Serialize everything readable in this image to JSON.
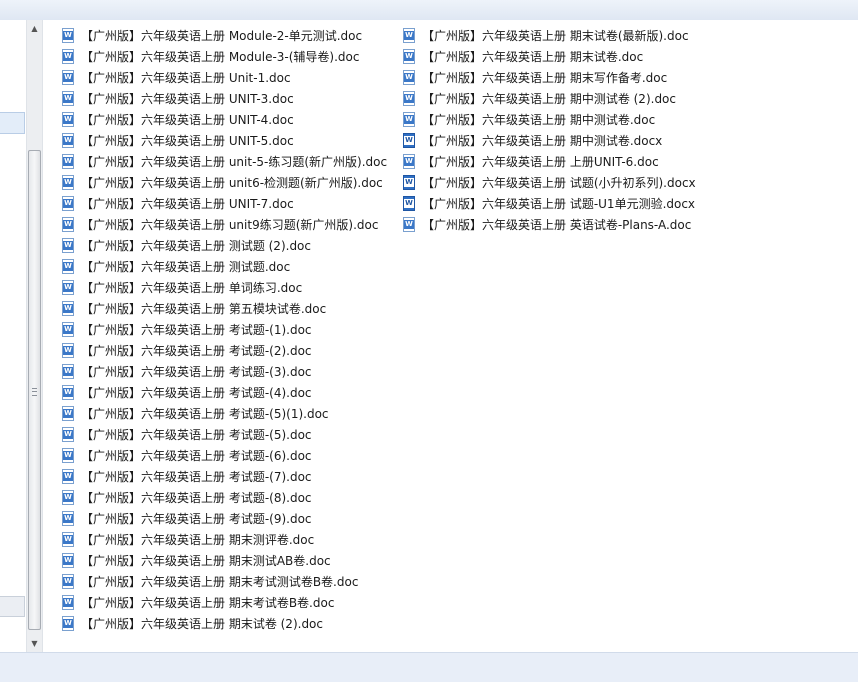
{
  "files_col1": [
    {
      "name": "【广州版】六年级英语上册 Module-2-单元测试.doc",
      "type": "doc"
    },
    {
      "name": "【广州版】六年级英语上册 Module-3-(辅导卷).doc",
      "type": "doc"
    },
    {
      "name": "【广州版】六年级英语上册 Unit-1.doc",
      "type": "doc"
    },
    {
      "name": "【广州版】六年级英语上册 UNIT-3.doc",
      "type": "doc"
    },
    {
      "name": "【广州版】六年级英语上册 UNIT-4.doc",
      "type": "doc"
    },
    {
      "name": "【广州版】六年级英语上册 UNIT-5.doc",
      "type": "doc"
    },
    {
      "name": "【广州版】六年级英语上册 unit-5-练习题(新广州版).doc",
      "type": "doc"
    },
    {
      "name": "【广州版】六年级英语上册 unit6-检测题(新广州版).doc",
      "type": "doc"
    },
    {
      "name": "【广州版】六年级英语上册 UNIT-7.doc",
      "type": "doc"
    },
    {
      "name": "【广州版】六年级英语上册 unit9练习题(新广州版).doc",
      "type": "doc"
    },
    {
      "name": "【广州版】六年级英语上册 测试题 (2).doc",
      "type": "doc"
    },
    {
      "name": "【广州版】六年级英语上册 测试题.doc",
      "type": "doc"
    },
    {
      "name": "【广州版】六年级英语上册 单词练习.doc",
      "type": "doc"
    },
    {
      "name": "【广州版】六年级英语上册 第五模块试卷.doc",
      "type": "doc"
    },
    {
      "name": "【广州版】六年级英语上册 考试题-(1).doc",
      "type": "doc"
    },
    {
      "name": "【广州版】六年级英语上册 考试题-(2).doc",
      "type": "doc"
    },
    {
      "name": "【广州版】六年级英语上册 考试题-(3).doc",
      "type": "doc"
    },
    {
      "name": "【广州版】六年级英语上册 考试题-(4).doc",
      "type": "doc"
    },
    {
      "name": "【广州版】六年级英语上册 考试题-(5)(1).doc",
      "type": "doc"
    },
    {
      "name": "【广州版】六年级英语上册 考试题-(5).doc",
      "type": "doc"
    },
    {
      "name": "【广州版】六年级英语上册 考试题-(6).doc",
      "type": "doc"
    },
    {
      "name": "【广州版】六年级英语上册 考试题-(7).doc",
      "type": "doc"
    },
    {
      "name": "【广州版】六年级英语上册 考试题-(8).doc",
      "type": "doc"
    },
    {
      "name": "【广州版】六年级英语上册 考试题-(9).doc",
      "type": "doc"
    },
    {
      "name": "【广州版】六年级英语上册 期末测评卷.doc",
      "type": "doc"
    },
    {
      "name": "【广州版】六年级英语上册 期末测试AB卷.doc",
      "type": "doc"
    },
    {
      "name": "【广州版】六年级英语上册 期末考试测试卷B卷.doc",
      "type": "doc"
    },
    {
      "name": "【广州版】六年级英语上册 期末考试卷B卷.doc",
      "type": "doc"
    },
    {
      "name": "【广州版】六年级英语上册 期末试卷 (2).doc",
      "type": "doc"
    }
  ],
  "files_col2": [
    {
      "name": "【广州版】六年级英语上册 期末试卷(最新版).doc",
      "type": "doc"
    },
    {
      "name": "【广州版】六年级英语上册 期末试卷.doc",
      "type": "doc"
    },
    {
      "name": "【广州版】六年级英语上册 期末写作备考.doc",
      "type": "doc"
    },
    {
      "name": "【广州版】六年级英语上册 期中测试卷 (2).doc",
      "type": "doc"
    },
    {
      "name": "【广州版】六年级英语上册 期中测试卷.doc",
      "type": "doc"
    },
    {
      "name": "【广州版】六年级英语上册 期中测试卷.docx",
      "type": "docx"
    },
    {
      "name": "【广州版】六年级英语上册 上册UNIT-6.doc",
      "type": "doc"
    },
    {
      "name": "【广州版】六年级英语上册 试题(小升初系列).docx",
      "type": "docx"
    },
    {
      "name": "【广州版】六年级英语上册 试题-U1单元测验.docx",
      "type": "docx"
    },
    {
      "name": "【广州版】六年级英语上册 英语试卷-Plans-A.doc",
      "type": "doc"
    }
  ],
  "icons": {
    "doc": "word-doc-icon",
    "docx": "word-docx-icon",
    "badge_letter": "W"
  },
  "scrollbar": {
    "up": "▲",
    "down": "▼"
  }
}
